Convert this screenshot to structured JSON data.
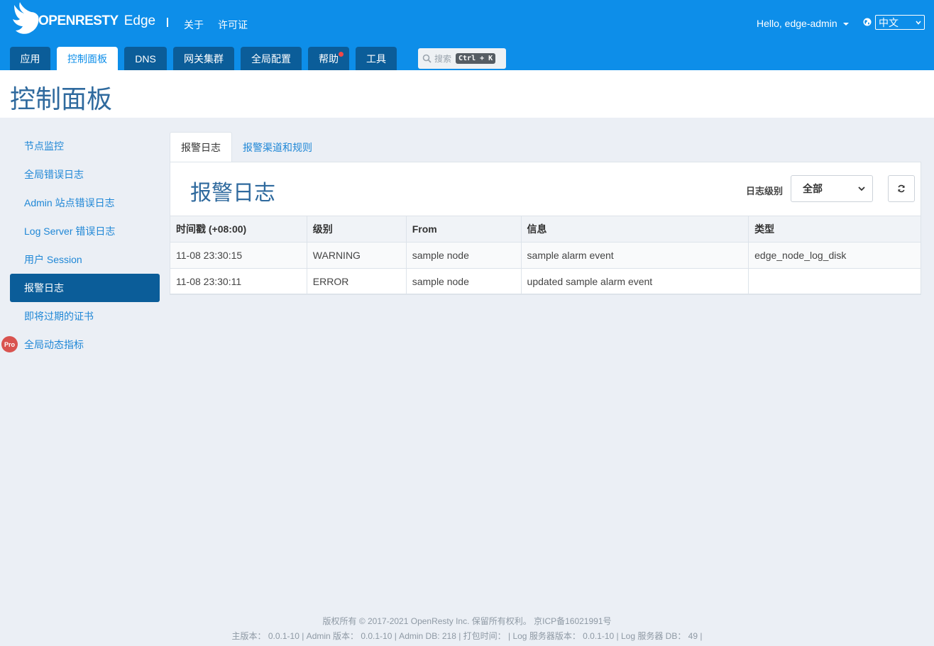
{
  "header": {
    "logo_text": "OPENRESTY",
    "product": "Edge",
    "links": [
      "关于",
      "许可证"
    ],
    "user": "Hello, edge-admin",
    "language": "中文"
  },
  "nav": {
    "tabs": [
      {
        "label": "应用",
        "active": false
      },
      {
        "label": "控制面板",
        "active": true
      },
      {
        "label": "DNS",
        "active": false
      },
      {
        "label": "网关集群",
        "active": false
      },
      {
        "label": "全局配置",
        "active": false
      },
      {
        "label": "帮助",
        "active": false,
        "dot": true
      },
      {
        "label": "工具",
        "active": false
      }
    ],
    "search_placeholder": "搜索",
    "search_shortcut": "Ctrl + K"
  },
  "page": {
    "title": "控制面板"
  },
  "sidebar": {
    "items": [
      {
        "label": "节点监控"
      },
      {
        "label": "全局错误日志"
      },
      {
        "label": "Admin 站点错误日志"
      },
      {
        "label": "Log Server 错误日志"
      },
      {
        "label": "用户 Session"
      },
      {
        "label": "报警日志",
        "active": true
      },
      {
        "label": "即将过期的证书"
      },
      {
        "label": "全局动态指标",
        "badge": "Pro"
      }
    ]
  },
  "main": {
    "subtabs": [
      "报警日志",
      "报警渠道和规则"
    ],
    "title": "报警日志",
    "level_label": "日志级别",
    "level_value": "全部",
    "table": {
      "headers": [
        "时间戳 (+08:00)",
        "级别",
        "From",
        "信息",
        "类型"
      ],
      "rows": [
        [
          "11-08 23:30:15",
          "WARNING",
          "sample node",
          "sample alarm event",
          "edge_node_log_disk"
        ],
        [
          "11-08 23:30:11",
          "ERROR",
          "sample node",
          "updated sample alarm event",
          ""
        ]
      ]
    }
  },
  "footer": {
    "line1": "版权所有 © 2017-2021 OpenResty Inc. 保留所有权利。 京ICP备16021991号",
    "line2": "主版本： 0.0.1-10 | Admin 版本： 0.0.1-10 | Admin DB: 218 | 打包时间： | Log 服务器版本： 0.0.1-10 | Log 服务器 DB： 49 |"
  }
}
